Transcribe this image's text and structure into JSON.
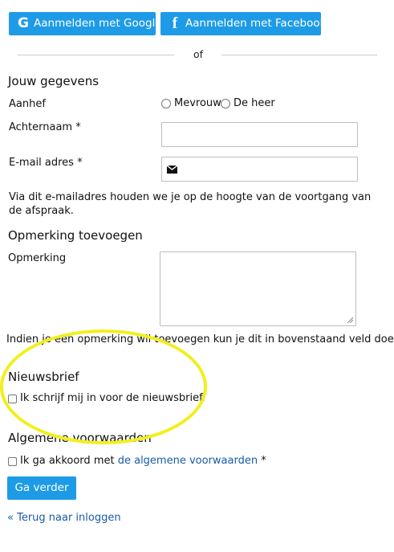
{
  "social": {
    "google_label": "Aanmelden met Google",
    "google_icon": "G",
    "facebook_label": "Aanmelden met Facebook",
    "facebook_icon": "f"
  },
  "divider_text": "of",
  "details": {
    "title": "Jouw gegevens",
    "salutation_label": "Aanhef",
    "salutation_options": [
      "Mevrouw",
      "De heer"
    ],
    "lastname_label": "Achternaam *",
    "lastname_value": "",
    "email_label": "E-mail adres *",
    "email_value": "",
    "email_help": "Via dit e-mailadres houden we je op de hoogte van de voortgang van de afspraak."
  },
  "remark": {
    "title": "Opmerking toevoegen",
    "label": "Opmerking",
    "value": "",
    "help": "Indien je een opmerking wil toevoegen kun je dit in bovenstaand veld doen."
  },
  "newsletter": {
    "title": "Nieuwsbrief",
    "checkbox_label": "Ik schrijf mij in voor de nieuwsbrief.",
    "checked": false
  },
  "terms": {
    "title": "Algemene voorwaarden",
    "prefix": "Ik ga akkoord met ",
    "link_text": "de algemene voorwaarden",
    "suffix": " *",
    "checked": false
  },
  "actions": {
    "continue_label": "Ga verder",
    "back_link": "« Terug naar inloggen"
  },
  "colors": {
    "accent": "#1e9be6",
    "link": "#1a5ba6",
    "highlight": "#f2ef1d"
  }
}
